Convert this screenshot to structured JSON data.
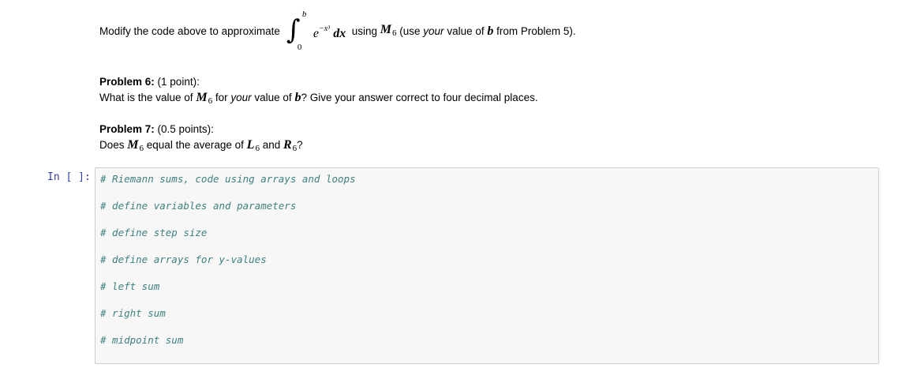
{
  "intro": {
    "prefix": "Modify the code above to approximate",
    "integral_upper": "b",
    "integral_lower": "0",
    "integrand_base": "e",
    "integrand_exp": "−x³",
    "integrand_dx": "dx",
    "using": "using",
    "method": "M",
    "method_sub": "6",
    "paren_pre": "(use",
    "paren_your": "your",
    "paren_mid": "value of",
    "paren_var": "b",
    "paren_post": "from Problem 5)."
  },
  "problem6": {
    "label": "Problem 6:",
    "points": "(1 point):",
    "q_pre": "What is the value of",
    "q_M": "M",
    "q_sub": "6",
    "q_mid": "for",
    "q_your": "your",
    "q_mid2": "value of",
    "q_b": "b",
    "q_post": "? Give your answer correct to four decimal places."
  },
  "problem7": {
    "label": "Problem 7:",
    "points": "(0.5 points):",
    "q_pre": "Does",
    "q_M": "M",
    "q_M_sub": "6",
    "q_mid": "equal the average of",
    "q_L": "L",
    "q_L_sub": "6",
    "q_and": "and",
    "q_R": "R",
    "q_R_sub": "6",
    "q_post": "?"
  },
  "cell": {
    "prompt": "In [ ]:",
    "lines": [
      "# Riemann sums, code using arrays and loops",
      "# define variables and parameters",
      "# define step size",
      "# define arrays for y-values",
      "# left sum",
      "# right sum",
      "# midpoint sum"
    ]
  }
}
